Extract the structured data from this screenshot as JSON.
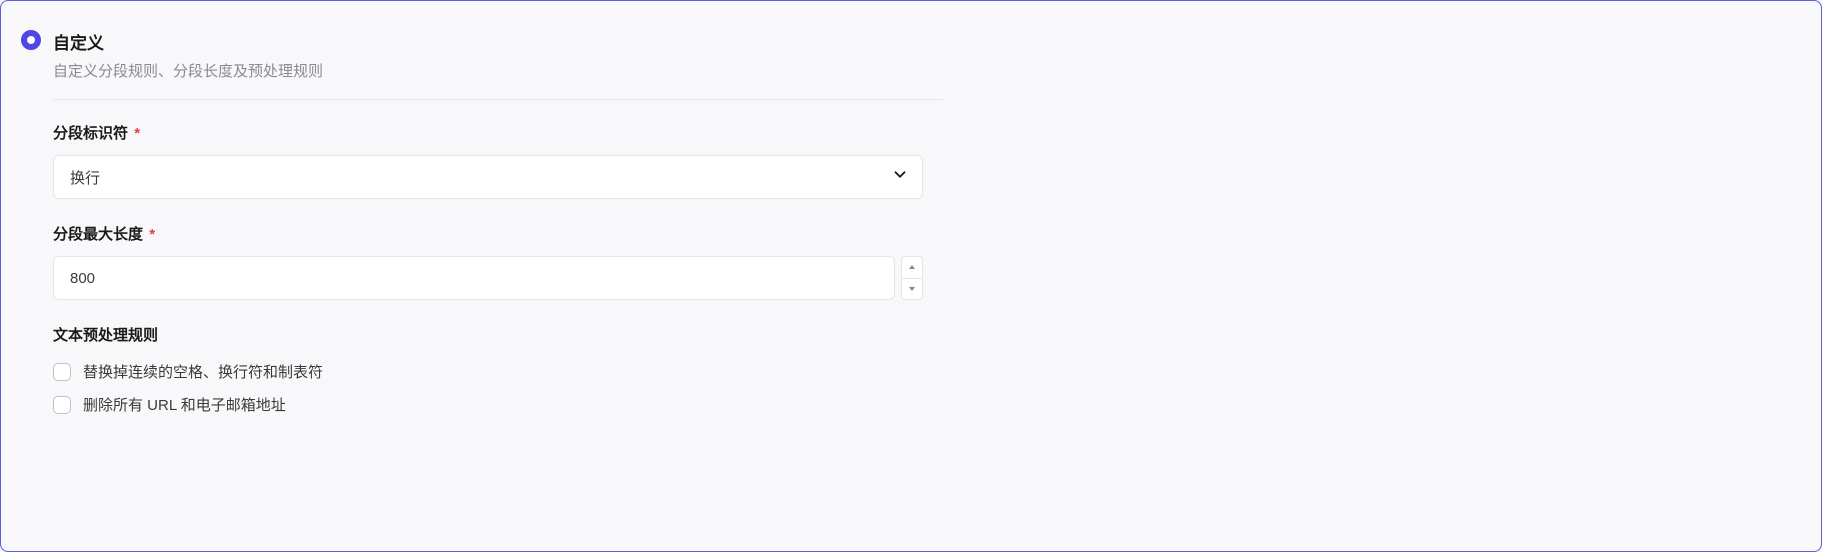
{
  "header": {
    "title": "自定义",
    "subtitle": "自定义分段规则、分段长度及预处理规则"
  },
  "fields": {
    "separator": {
      "label": "分段标识符",
      "required_mark": "*",
      "value": "换行"
    },
    "maxLength": {
      "label": "分段最大长度",
      "required_mark": "*",
      "value": "800"
    }
  },
  "preprocess": {
    "title": "文本预处理规则",
    "options": [
      "替换掉连续的空格、换行符和制表符",
      "删除所有 URL 和电子邮箱地址"
    ]
  }
}
